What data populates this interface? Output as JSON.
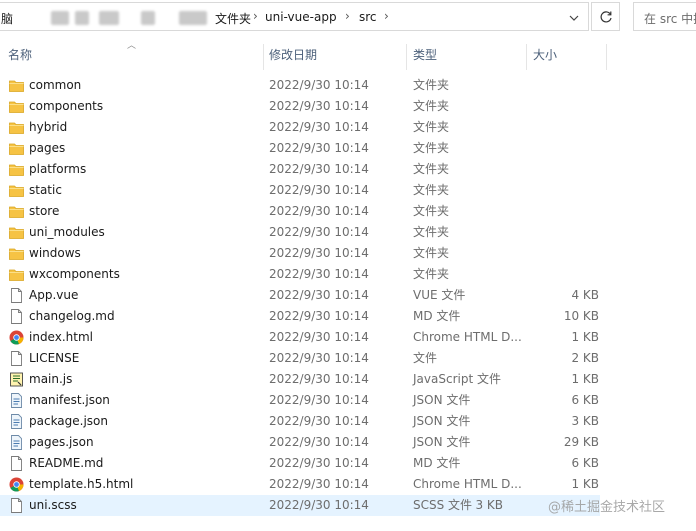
{
  "address_bar": {
    "crumbs": [
      "脑",
      "文件夹",
      "uni-vue-app",
      "src"
    ],
    "separator": "›"
  },
  "search": {
    "placeholder": "在 src 中搜"
  },
  "columns": {
    "name": "名称",
    "date": "修改日期",
    "type": "类型",
    "size": "大小"
  },
  "files": [
    {
      "name": "common",
      "date": "2022/9/30 10:14",
      "type": "文件夹",
      "size": "",
      "icon": "folder-icon"
    },
    {
      "name": "components",
      "date": "2022/9/30 10:14",
      "type": "文件夹",
      "size": "",
      "icon": "folder-icon"
    },
    {
      "name": "hybrid",
      "date": "2022/9/30 10:14",
      "type": "文件夹",
      "size": "",
      "icon": "folder-icon"
    },
    {
      "name": "pages",
      "date": "2022/9/30 10:14",
      "type": "文件夹",
      "size": "",
      "icon": "folder-icon"
    },
    {
      "name": "platforms",
      "date": "2022/9/30 10:14",
      "type": "文件夹",
      "size": "",
      "icon": "folder-icon"
    },
    {
      "name": "static",
      "date": "2022/9/30 10:14",
      "type": "文件夹",
      "size": "",
      "icon": "folder-icon"
    },
    {
      "name": "store",
      "date": "2022/9/30 10:14",
      "type": "文件夹",
      "size": "",
      "icon": "folder-icon"
    },
    {
      "name": "uni_modules",
      "date": "2022/9/30 10:14",
      "type": "文件夹",
      "size": "",
      "icon": "folder-icon"
    },
    {
      "name": "windows",
      "date": "2022/9/30 10:14",
      "type": "文件夹",
      "size": "",
      "icon": "folder-icon"
    },
    {
      "name": "wxcomponents",
      "date": "2022/9/30 10:14",
      "type": "文件夹",
      "size": "",
      "icon": "folder-icon"
    },
    {
      "name": "App.vue",
      "date": "2022/9/30 10:14",
      "type": "VUE 文件",
      "size": "4 KB",
      "icon": "file-icon"
    },
    {
      "name": "changelog.md",
      "date": "2022/9/30 10:14",
      "type": "MD 文件",
      "size": "10 KB",
      "icon": "file-icon"
    },
    {
      "name": "index.html",
      "date": "2022/9/30 10:14",
      "type": "Chrome HTML D...",
      "size": "1 KB",
      "icon": "chrome-icon"
    },
    {
      "name": "LICENSE",
      "date": "2022/9/30 10:14",
      "type": "文件",
      "size": "2 KB",
      "icon": "file-icon"
    },
    {
      "name": "main.js",
      "date": "2022/9/30 10:14",
      "type": "JavaScript 文件",
      "size": "1 KB",
      "icon": "script-icon"
    },
    {
      "name": "manifest.json",
      "date": "2022/9/30 10:14",
      "type": "JSON 文件",
      "size": "6 KB",
      "icon": "json-icon"
    },
    {
      "name": "package.json",
      "date": "2022/9/30 10:14",
      "type": "JSON 文件",
      "size": "3 KB",
      "icon": "json-icon"
    },
    {
      "name": "pages.json",
      "date": "2022/9/30 10:14",
      "type": "JSON 文件",
      "size": "29 KB",
      "icon": "json-icon"
    },
    {
      "name": "README.md",
      "date": "2022/9/30 10:14",
      "type": "MD 文件",
      "size": "6 KB",
      "icon": "file-icon"
    },
    {
      "name": "template.h5.html",
      "date": "2022/9/30 10:14",
      "type": "Chrome HTML D...",
      "size": "1 KB",
      "icon": "chrome-icon"
    },
    {
      "name": "uni.scss",
      "date": "2022/9/30 10:14",
      "type": "SCSS 文件",
      "size": "3 KB",
      "icon": "file-icon",
      "selected": true
    }
  ],
  "watermark": "@稀土掘金技术社区",
  "colors": {
    "folder": "#f6c344",
    "selection": "#e5f3ff",
    "header_text": "#4c607a"
  }
}
